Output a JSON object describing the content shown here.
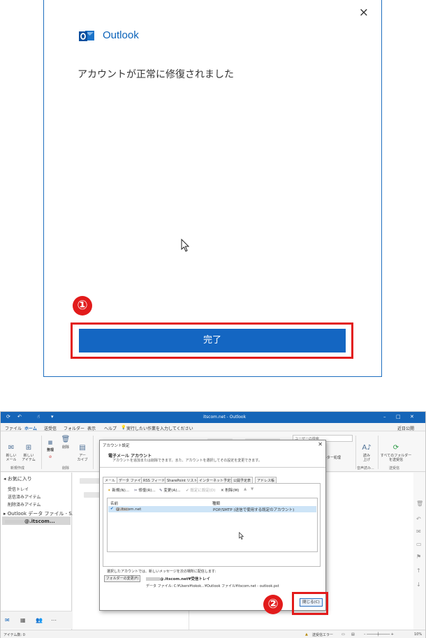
{
  "dialog1": {
    "brand": "Outlook",
    "message": "アカウントが正常に修復されました",
    "done_button": "完了",
    "close_icon": "×",
    "step_marker": "①"
  },
  "outlook_window": {
    "title": "itscom.net - Outlook",
    "menu": [
      "ファイル",
      "ホーム",
      "送受信",
      "フォルダー",
      "表示",
      "ヘルプ"
    ],
    "tell_me": "実行したい作業を入力してください",
    "coming_soon": "近日公開",
    "search_placeholder": "ユーザーの検索",
    "ribbon": {
      "new_mail": "新しい\nメール",
      "new_items": "新しい\nアイテム",
      "ignore": "無視",
      "cleanup": "整理",
      "junk": "迷惑",
      "delete": "削除",
      "archive": "アー\nカイブ",
      "read_aloud": "読み\n上げ",
      "send_receive_all": "すべてのフォルダー\nを送受信",
      "filter": "フィルター処理",
      "group_new": "新規作成",
      "group_delete": "削除",
      "group_speech": "音声読み...",
      "group_sendrecv": "送受信"
    },
    "nav": {
      "favorites": "お気に入り",
      "inbox": "受信トレイ",
      "sent": "送信済みアイテム",
      "deleted": "削除済みアイテム",
      "data_file": "Outlook データ ファイル - S...",
      "account": "@.itscom..."
    },
    "status": {
      "items": "アイテム数: 0",
      "send_receive_error": "送受信エラー",
      "zoom": "10%"
    }
  },
  "account_dialog": {
    "title": "アカウント設定",
    "heading": "電子メール アカウント",
    "subheading": "アカウントを追加または削除できます。また、アカウントを選択してその設定を変更できます。",
    "tabs": [
      "メール",
      "データ ファイル",
      "RSS フィード",
      "SharePoint リスト",
      "インターネット予定表",
      "公開予定表",
      "アドレス帳"
    ],
    "toolbar": {
      "new": "新規(N)...",
      "repair": "修復(R)...",
      "change": "変更(A)...",
      "set_default": "既定に設定(D)",
      "delete": "削除(M)"
    },
    "columns": [
      "名前",
      "種類"
    ],
    "account_name": "@.itscom.net",
    "account_type": "POP/SMTP (送信で使用する既定のアカウント)",
    "deliver_label": "選択したアカウントでは、新しいメッセージを次の場所に配信します:",
    "change_folder_button": "フォルダーの変更(F)",
    "folder_location": "@.itscom.net¥受信トレイ",
    "data_file": "データ ファイル: C:¥Users¥tokok...¥Outlook ファイル¥itscom.net - outlook.pst",
    "close_button": "閉じる(C)",
    "step_marker": "②"
  },
  "colors": {
    "brand_blue": "#1466c2",
    "highlight_red": "#e21b1b"
  }
}
